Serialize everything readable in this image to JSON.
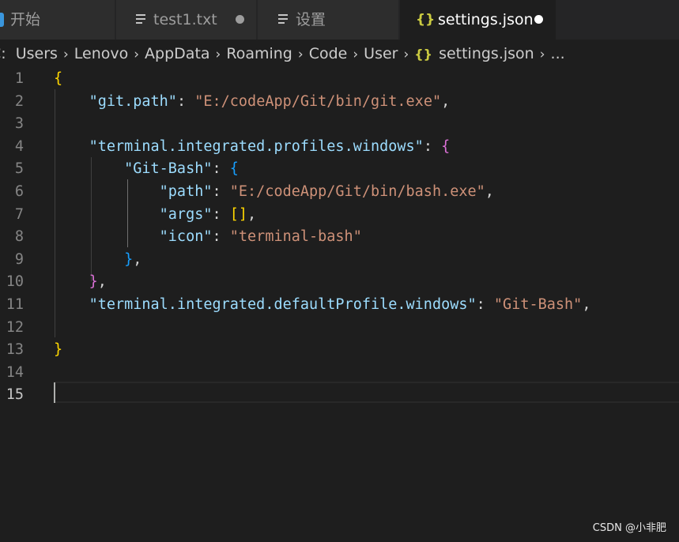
{
  "tabs": [
    {
      "label": "开始",
      "icon": "vscode-logo-icon",
      "active": false,
      "dirty": false
    },
    {
      "label": "test1.txt",
      "icon": "text-file-icon",
      "active": false,
      "dirty": true
    },
    {
      "label": "设置",
      "icon": "text-file-icon",
      "active": false,
      "dirty": false
    },
    {
      "label": "settings.json",
      "icon": "json-braces-icon",
      "active": true,
      "dirty": true
    }
  ],
  "tab_json_glyph": "{}",
  "breadcrumb": {
    "items": [
      "C:",
      "Users",
      "Lenovo",
      "AppData",
      "Roaming",
      "Code",
      "User",
      "settings.json",
      "..."
    ],
    "json_glyph": "{}"
  },
  "editor": {
    "line_numbers": [
      "1",
      "2",
      "3",
      "4",
      "5",
      "6",
      "7",
      "8",
      "9",
      "10",
      "11",
      "12",
      "13",
      "14",
      "15"
    ],
    "current_line": 15,
    "lines": [
      [
        {
          "t": "{",
          "c": "b1"
        }
      ],
      [
        {
          "t": "    ",
          "c": "pun"
        },
        {
          "t": "\"git.path\"",
          "c": "key"
        },
        {
          "t": ": ",
          "c": "pun"
        },
        {
          "t": "\"E:/codeApp/Git/bin/git.exe\"",
          "c": "str"
        },
        {
          "t": ",",
          "c": "pun"
        }
      ],
      [],
      [
        {
          "t": "    ",
          "c": "pun"
        },
        {
          "t": "\"terminal.integrated.profiles.windows\"",
          "c": "key"
        },
        {
          "t": ": ",
          "c": "pun"
        },
        {
          "t": "{",
          "c": "b2"
        }
      ],
      [
        {
          "t": "        ",
          "c": "pun"
        },
        {
          "t": "\"Git-Bash\"",
          "c": "key"
        },
        {
          "t": ": ",
          "c": "pun"
        },
        {
          "t": "{",
          "c": "b3"
        }
      ],
      [
        {
          "t": "            ",
          "c": "pun"
        },
        {
          "t": "\"path\"",
          "c": "key"
        },
        {
          "t": ": ",
          "c": "pun"
        },
        {
          "t": "\"E:/codeApp/Git/bin/bash.exe\"",
          "c": "str"
        },
        {
          "t": ",",
          "c": "pun"
        }
      ],
      [
        {
          "t": "            ",
          "c": "pun"
        },
        {
          "t": "\"args\"",
          "c": "key"
        },
        {
          "t": ": ",
          "c": "pun"
        },
        {
          "t": "[]",
          "c": "b1"
        },
        {
          "t": ",",
          "c": "pun"
        }
      ],
      [
        {
          "t": "            ",
          "c": "pun"
        },
        {
          "t": "\"icon\"",
          "c": "key"
        },
        {
          "t": ": ",
          "c": "pun"
        },
        {
          "t": "\"terminal-bash\"",
          "c": "str"
        }
      ],
      [
        {
          "t": "        ",
          "c": "pun"
        },
        {
          "t": "}",
          "c": "b3"
        },
        {
          "t": ",",
          "c": "pun"
        }
      ],
      [
        {
          "t": "    ",
          "c": "pun"
        },
        {
          "t": "}",
          "c": "b2"
        },
        {
          "t": ",",
          "c": "pun"
        }
      ],
      [
        {
          "t": "    ",
          "c": "pun"
        },
        {
          "t": "\"terminal.integrated.defaultProfile.windows\"",
          "c": "key"
        },
        {
          "t": ": ",
          "c": "pun"
        },
        {
          "t": "\"Git-Bash\"",
          "c": "str"
        },
        {
          "t": ",",
          "c": "pun"
        }
      ],
      [],
      [
        {
          "t": "}",
          "c": "b1"
        }
      ],
      [],
      []
    ]
  },
  "watermark": "CSDN @小非肥",
  "colors": {
    "background": "#1e1e1e",
    "tab_inactive": "#2d2d2d",
    "json_key": "#9cdcfe",
    "json_string": "#ce9178",
    "bracket_level1": "#ffd700",
    "bracket_level2": "#da70d6",
    "bracket_level3": "#179fff"
  }
}
